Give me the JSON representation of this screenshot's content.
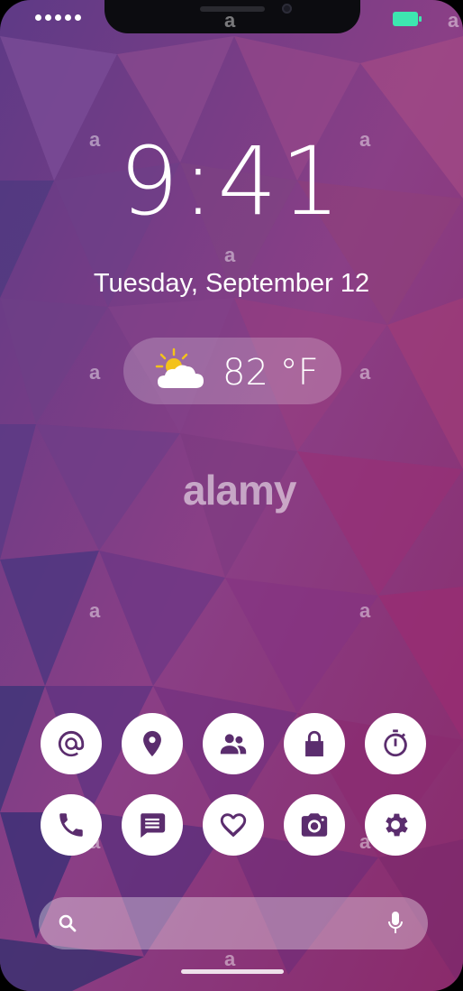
{
  "status_bar": {
    "signal_dots": 5,
    "battery_color": "#3de6b0"
  },
  "lock_screen": {
    "time": "9:41",
    "date": "Tuesday, September 12",
    "weather": {
      "icon": "partly-cloudy-icon",
      "temperature": "82 °F"
    }
  },
  "apps": [
    {
      "name": "email-button",
      "icon": "at-sign-icon"
    },
    {
      "name": "location-button",
      "icon": "map-pin-icon"
    },
    {
      "name": "contacts-button",
      "icon": "people-icon"
    },
    {
      "name": "lock-button",
      "icon": "padlock-icon"
    },
    {
      "name": "timer-button",
      "icon": "stopwatch-icon"
    },
    {
      "name": "phone-button",
      "icon": "phone-handset-icon"
    },
    {
      "name": "messages-button",
      "icon": "chat-bubble-icon"
    },
    {
      "name": "favorites-button",
      "icon": "heart-icon"
    },
    {
      "name": "camera-button",
      "icon": "camera-icon"
    },
    {
      "name": "settings-button",
      "icon": "gear-icon"
    }
  ],
  "search": {
    "placeholder": "",
    "value": ""
  },
  "watermark": {
    "main": "alamy",
    "letter": "a"
  },
  "colors": {
    "icon_fill": "#5b2d6e",
    "wallpaper_top": "#6a3d8c",
    "wallpaper_bottom": "#9a2d6a"
  }
}
